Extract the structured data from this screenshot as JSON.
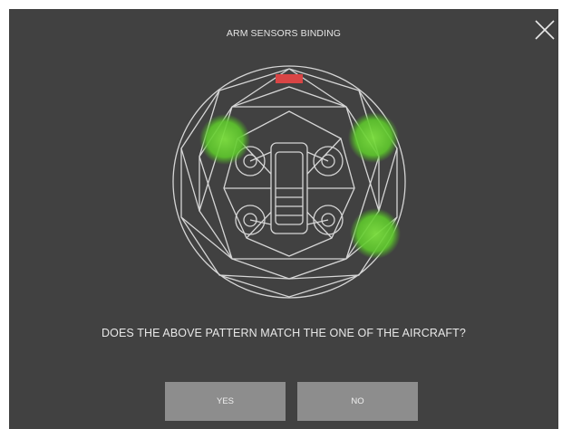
{
  "dialog": {
    "title": "ARM SENSORS BINDING",
    "question": "DOES THE ABOVE PATTERN MATCH THE ONE OF THE AIRCRAFT?",
    "close_icon": "close-icon",
    "illustration": "caged-drone-illustration",
    "sensor_indicators": [
      "top-left-arm",
      "top-right-arm",
      "bottom-right-arm"
    ],
    "indicator_color": "#6fd43a",
    "buttons": {
      "yes_label": "YES",
      "no_label": "NO"
    }
  },
  "colors": {
    "background": "#414141",
    "button": "#8d8d8d",
    "text": "#e8e8e8"
  }
}
